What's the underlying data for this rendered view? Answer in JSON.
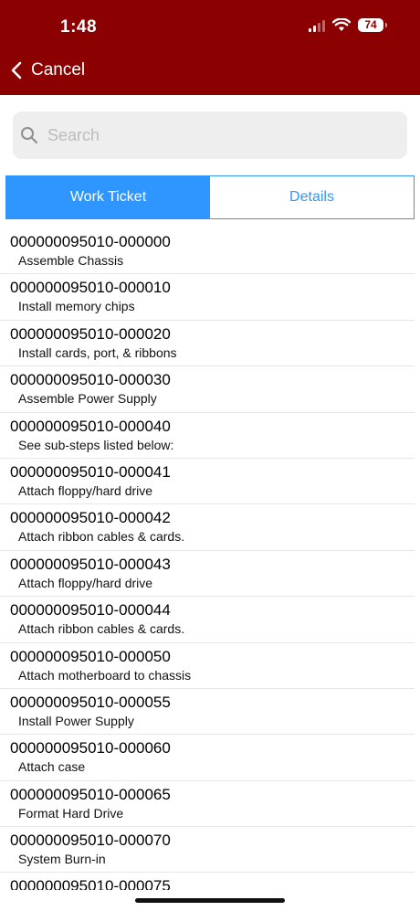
{
  "status": {
    "time": "1:48",
    "battery": "74"
  },
  "nav": {
    "back_label": "Cancel"
  },
  "search": {
    "placeholder": "Search"
  },
  "tabs": [
    {
      "label": "Work Ticket",
      "active": true
    },
    {
      "label": "Details",
      "active": false
    }
  ],
  "items": [
    {
      "code": "000000095010-000000",
      "desc": "Assemble Chassis"
    },
    {
      "code": "000000095010-000010",
      "desc": "Install memory chips"
    },
    {
      "code": "000000095010-000020",
      "desc": "Install cards, port, & ribbons"
    },
    {
      "code": "000000095010-000030",
      "desc": "Assemble Power Supply"
    },
    {
      "code": "000000095010-000040",
      "desc": "See sub-steps listed below:"
    },
    {
      "code": "000000095010-000041",
      "desc": "Attach floppy/hard drive"
    },
    {
      "code": "000000095010-000042",
      "desc": "Attach ribbon cables & cards."
    },
    {
      "code": "000000095010-000043",
      "desc": "Attach floppy/hard drive"
    },
    {
      "code": "000000095010-000044",
      "desc": "Attach ribbon cables & cards."
    },
    {
      "code": "000000095010-000050",
      "desc": "Attach motherboard to chassis"
    },
    {
      "code": "000000095010-000055",
      "desc": "Install Power Supply"
    },
    {
      "code": "000000095010-000060",
      "desc": "Attach case"
    },
    {
      "code": "000000095010-000065",
      "desc": "Format Hard Drive"
    },
    {
      "code": "000000095010-000070",
      "desc": "System Burn-in"
    },
    {
      "code": "000000095010-000075",
      "desc": ""
    }
  ],
  "colors": {
    "header": "#8b0000",
    "accent": "#2f95ff"
  }
}
